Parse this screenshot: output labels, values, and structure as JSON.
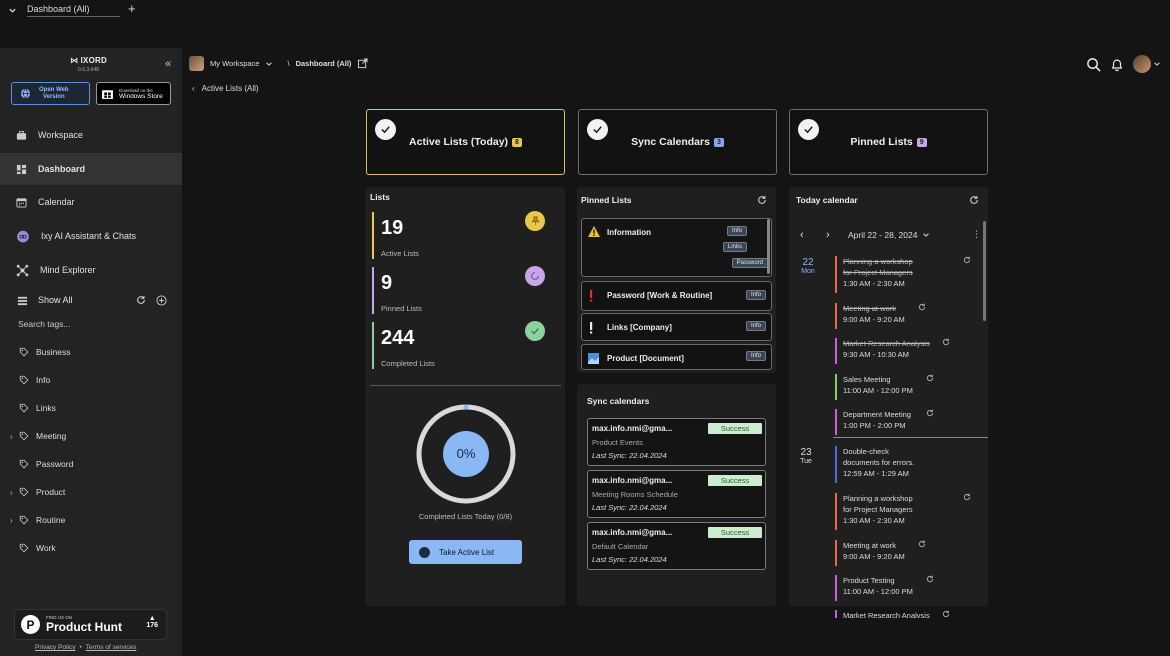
{
  "tab": {
    "label": "Dashboard (All)",
    "plus": "+"
  },
  "brand": {
    "name": "IXORD",
    "version": "0.6.3.648"
  },
  "buttons": {
    "web_line1": "Open Web",
    "web_line2": "Version",
    "store_line1": "Download on the",
    "store_line2": "Windows Store"
  },
  "nav": [
    {
      "label": "Workspace",
      "icon": "briefcase-icon"
    },
    {
      "label": "Dashboard",
      "icon": "dashboard-icon"
    },
    {
      "label": "Calendar",
      "icon": "calendar-icon"
    },
    {
      "label": "Ixy AI Assistant & Chats",
      "icon": "robot-icon"
    },
    {
      "label": "Mind Explorer",
      "icon": "network-icon"
    }
  ],
  "tags": {
    "show_all": "Show All",
    "search_placeholder": "Search tags...",
    "items": [
      {
        "label": "Business",
        "expandable": false
      },
      {
        "label": "Info",
        "expandable": false
      },
      {
        "label": "Links",
        "expandable": false
      },
      {
        "label": "Meeting",
        "expandable": true
      },
      {
        "label": "Password",
        "expandable": false
      },
      {
        "label": "Product",
        "expandable": true
      },
      {
        "label": "Routine",
        "expandable": true
      },
      {
        "label": "Work",
        "expandable": false
      }
    ]
  },
  "producthunt": {
    "small": "FIND US ON",
    "big": "Product Hunt",
    "votes": "176"
  },
  "footer": {
    "privacy": "Privacy Policy",
    "sep": "•",
    "terms": "Terms of services"
  },
  "header": {
    "workspace": "My Workspace",
    "separator": "\\",
    "dashboard": "Dashboard (All)"
  },
  "back": {
    "label": "Active Lists (All)"
  },
  "top_cards": [
    {
      "label": "Active Lists (Today)",
      "count": "8",
      "badge_color": "#e8c84a",
      "active": true
    },
    {
      "label": "Sync Calendars",
      "count": "3",
      "badge_color": "#8ea6e8",
      "active": false
    },
    {
      "label": "Pinned Lists",
      "count": "9",
      "badge_color": "#c9a6ea",
      "active": false
    }
  ],
  "lists": {
    "title": "Lists",
    "stats": [
      {
        "value": "19",
        "label": "Active Lists",
        "color": "#e8c84a"
      },
      {
        "value": "9",
        "label": "Pinned Lists",
        "color": "#c9a6ea"
      },
      {
        "value": "244",
        "label": "Completed Lists",
        "color": "#8fd19e"
      }
    ],
    "progress_percent": 0,
    "progress_label": "0%",
    "completed_caption": "Completed Lists Today (0/8)",
    "take_button": "Take Active List"
  },
  "pinned": {
    "title": "Pinned Lists",
    "items": [
      {
        "title": "Information",
        "tags": [
          "Info",
          "Links",
          "Password"
        ],
        "icon": "warning-icon"
      },
      {
        "title": "Password [Work & Routine]",
        "tags": [
          "Info"
        ],
        "icon": "exclamation-red-icon"
      },
      {
        "title": "Links [Company]",
        "tags": [
          "Info"
        ],
        "icon": "exclamation-white-icon"
      },
      {
        "title": "Product [Document]",
        "tags": [
          "Info"
        ],
        "icon": "image-icon"
      }
    ]
  },
  "sync": {
    "title": "Sync calendars",
    "items": [
      {
        "email": "max.info.nmi@gma...",
        "name": "Product Events",
        "date": "Last Sync: 22.04.2024",
        "status": "Success"
      },
      {
        "email": "max.info.nmi@gma...",
        "name": "Meeting Rooms Schedule",
        "date": "Last Sync: 22.04.2024",
        "status": "Success"
      },
      {
        "email": "max.info.nmi@gma...",
        "name": "Default Calendar",
        "date": "Last Sync: 22.04.2024",
        "status": "Success"
      }
    ]
  },
  "calendar": {
    "title": "Today calendar",
    "range": "April 22 - 28, 2024",
    "days": [
      {
        "num": "22",
        "dow": "Mon"
      },
      {
        "num": "23",
        "dow": "Tue"
      }
    ],
    "events": [
      {
        "t1": "Planning a workshop",
        "t2": "for Project Managers",
        "time": "1:30 AM - 2:30 AM",
        "color": "#e8684a",
        "done": true,
        "sync": true
      },
      {
        "t1": "Meeting at work",
        "t2": "",
        "time": "9:00 AM - 9:20 AM",
        "color": "#e8684a",
        "done": true,
        "sync": true
      },
      {
        "t1": "Market Research Analysis",
        "t2": "",
        "time": "9:30 AM - 10:30 AM",
        "color": "#c761d9",
        "done": true,
        "sync": true
      },
      {
        "t1": "Sales Meeting",
        "t2": "",
        "time": "11:00 AM - 12:00 PM",
        "color": "#79d65a",
        "done": false,
        "sync": true
      },
      {
        "t1": "Department Meeting",
        "t2": "",
        "time": "1:00 PM - 2:00 PM",
        "color": "#c761d9",
        "done": false,
        "sync": true
      },
      {
        "t1": "Double-check",
        "t2": "documents for errors.",
        "time": "12:59 AM - 1:29 AM",
        "color": "#4a6bd8",
        "done": false,
        "sync": false
      },
      {
        "t1": "Planning a workshop",
        "t2": "for Project Managers",
        "time": "1:30 AM - 2:30 AM",
        "color": "#e8684a",
        "done": false,
        "sync": true
      },
      {
        "t1": "Meeting at work",
        "t2": "",
        "time": "9:00 AM - 9:20 AM",
        "color": "#e8684a",
        "done": false,
        "sync": true
      },
      {
        "t1": "Product Testing",
        "t2": "",
        "time": "11:00 AM - 12:00 PM",
        "color": "#c761d9",
        "done": false,
        "sync": true
      },
      {
        "t1": "Market Research Analysis",
        "t2": "",
        "time": "",
        "color": "#c761d9",
        "done": false,
        "sync": true
      }
    ]
  }
}
